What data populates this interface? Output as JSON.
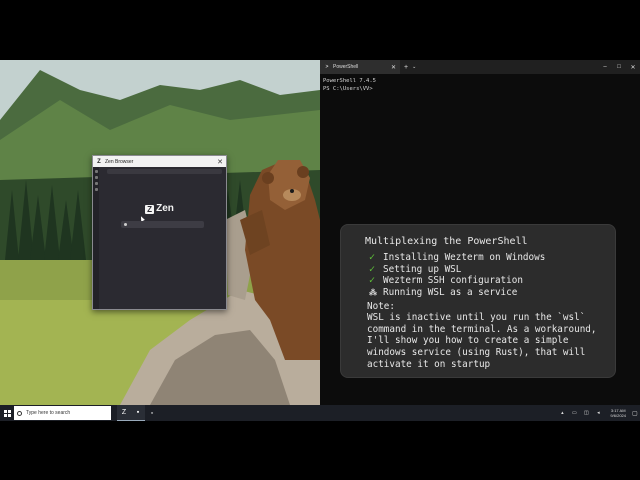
{
  "zen_window": {
    "title": "Zen Browser",
    "close": "✕",
    "logo_text": "Zen",
    "logo_mark": "Z"
  },
  "terminal": {
    "tab_title": "PowerShell",
    "tab_close": "✕",
    "new_tab": "+",
    "dropdown": "⌄",
    "minimize": "–",
    "maximize": "□",
    "close": "✕",
    "lines": [
      "PowerShell 7.4.5",
      "PS C:\\Users\\VV>"
    ]
  },
  "info_card": {
    "title": "Multiplexing the PowerShell",
    "items": [
      {
        "mark": "✓",
        "text": "Installing Wezterm on Windows"
      },
      {
        "mark": "✓",
        "text": "Setting up WSL"
      },
      {
        "mark": "✓",
        "text": "Wezterm SSH configuration"
      },
      {
        "mark": "⁂",
        "text": "Running WSL as a service"
      }
    ],
    "note_label": "Note:",
    "note_text": "WSL is inactive until you run the `wsl` command in the terminal. As a workaround, I'll show you how to create a simple windows service (using Rust), that will activate it on startup"
  },
  "taskbar": {
    "search_placeholder": "Type here to search",
    "clock_time": "3:17 AM",
    "clock_date": "9/6/2024",
    "task_icons": [
      "zen-browser-icon",
      "terminal-icon",
      "app-icon"
    ]
  },
  "colors": {
    "check_green": "#5ec238",
    "card_bg": "#2c2c2c",
    "terminal_bg": "#0c0c0c",
    "taskbar_bg": "#1c1f26"
  }
}
